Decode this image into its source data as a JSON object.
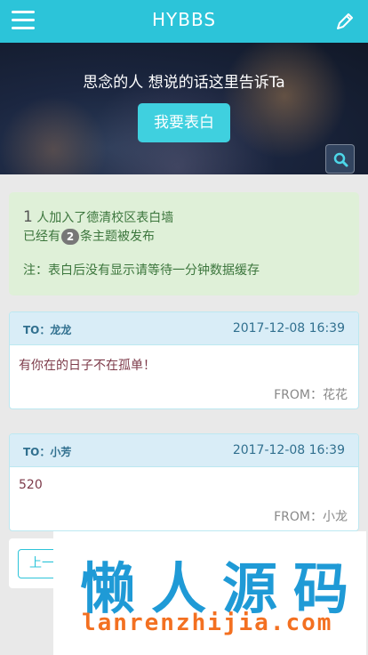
{
  "header": {
    "title": "HYBBS"
  },
  "banner": {
    "slogan": "思念的人 想说的话这里告诉Ta",
    "button_label": "我要表白"
  },
  "info": {
    "count": "1",
    "joined_text": " 人加入了德清校区表白墙",
    "prefix": "已经有",
    "topics": "2",
    "suffix": "条主题被发布",
    "note": "注：表白后没有显示请等待一分钟数据缓存"
  },
  "posts": [
    {
      "to": "TO：龙龙",
      "date": "2017-12-08 16:39",
      "message": "有你在的日子不在孤单！",
      "from": "FROM：花花"
    },
    {
      "to": "TO：小芳",
      "date": "2017-12-08 16:39",
      "message": "520",
      "from": "FROM：小龙"
    }
  ],
  "pager": {
    "prev_label": "上一"
  },
  "watermark": {
    "title": "懒人源码",
    "url": "lanrenzhijia.com"
  },
  "colors": {
    "primary": "#2cc4d9",
    "info_bg": "#dff0d8",
    "card_head_bg": "#d9edf7"
  }
}
